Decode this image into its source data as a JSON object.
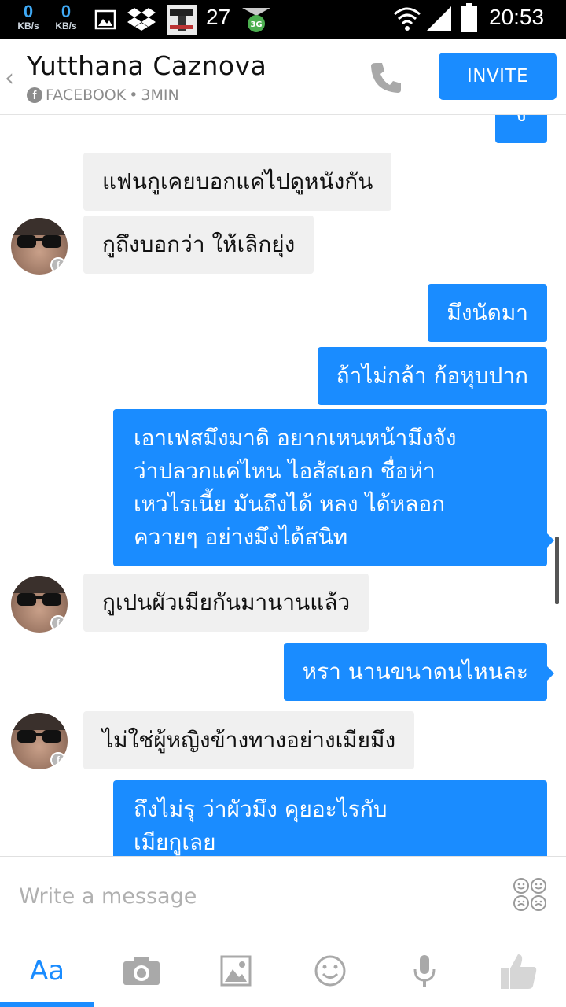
{
  "status_bar": {
    "down_speed": "0",
    "down_unit": "KB/s",
    "up_speed": "0",
    "up_unit": "KB/s",
    "notification_count": "27",
    "time": "20:53",
    "icons": [
      "image-icon",
      "dropbox-icon",
      "app-thumbnail-icon",
      "shield-3g-icon",
      "wifi-icon",
      "signal-icon",
      "battery-icon"
    ]
  },
  "header": {
    "contact_name": "Yutthana Caznova",
    "source": "FACEBOOK",
    "separator": "•",
    "time_ago": "3MIN",
    "invite_label": "INVITE",
    "accent_color": "#1a8cff"
  },
  "messages": [
    {
      "direction": "out",
      "text": "ง"
    },
    {
      "direction": "in",
      "text": "แฟนกูเคยบอกแค่ไปดูหนังกัน"
    },
    {
      "direction": "in",
      "text": "กูถึงบอกว่า ให้เลิกยุ่ง"
    },
    {
      "direction": "out",
      "text": "มึงนัดมา"
    },
    {
      "direction": "out",
      "text": "ถ้าไม่กล้า ก้อหุบปาก"
    },
    {
      "direction": "out",
      "lines": [
        "เอาเฟสมึงมาดิ อยากเหนหน้ามึงจัง",
        "ว่าปลวกแค่ไหน ไอสัสเอก ชื่อห่า",
        "เหวไรเนี้ย มันถึงได้ หลง ได้หลอก",
        "ควายๆ อย่างมึงได้สนิท"
      ]
    },
    {
      "direction": "in",
      "text": "กูเปนผัวเมียกันมานานแล้ว"
    },
    {
      "direction": "out",
      "text": "หรา นานขนาดนไหนละ"
    },
    {
      "direction": "in",
      "text": "ไม่ใช่ผู้หญิงข้างทางอย่างเมียมึง"
    },
    {
      "direction": "out",
      "lines": [
        "ถึงไม่รุ ว่าผัวมึง คุยอะไรกับ",
        "เมียกูเลย"
      ]
    }
  ],
  "composer": {
    "placeholder": "Write a message"
  },
  "toolbar": {
    "text_tab_label": "Aa",
    "icons": [
      "camera-icon",
      "gallery-icon",
      "emoji-icon",
      "microphone-icon",
      "like-icon"
    ]
  }
}
